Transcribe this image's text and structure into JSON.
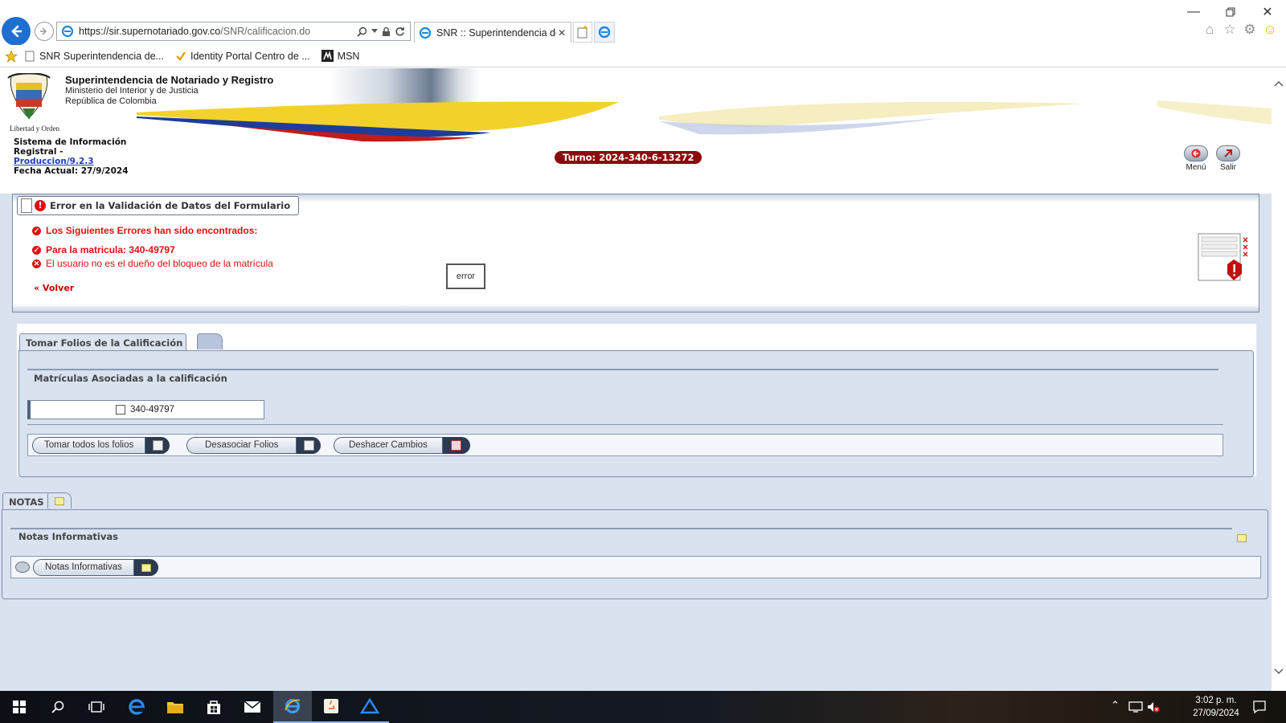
{
  "browser": {
    "url_host": "https://sir.supernotariado.gov.co",
    "url_path": "/SNR/calificacion.do",
    "tab_title": "SNR :: Superintendencia de ...",
    "favorites": [
      {
        "label": "SNR  Superintendencia de..."
      },
      {
        "label": "Identity Portal Centro de ..."
      },
      {
        "label": "MSN"
      }
    ]
  },
  "header": {
    "org_name": "Superintendencia de Notariado y Registro",
    "ministry": "Ministerio del Interior y de Justicia",
    "country": "República de Colombia",
    "motto": "Libertad y Orden",
    "system_line1": "Sistema de Información",
    "system_line2": "Registral -",
    "version_link": "Produccion/9.2.3",
    "fecha": "Fecha Actual: 27/9/2024",
    "turno": "Turno: 2024-340-6-13272",
    "menu_label": "Menú",
    "salir_label": "Salir"
  },
  "error_panel": {
    "title": "Error en la Validación de Datos del Formulario",
    "heading": "Los Siguientes Errores han sido encontrados:",
    "matricula_line": "Para la matricula: 340-49797",
    "detail": "El usuario no es el dueño del bloqueo de la matrícula",
    "back_link": "« Volver",
    "error_box": "error"
  },
  "calificacion": {
    "tab_label": "Tomar Folios de la Calificación",
    "section_title": "Matrículas Asociadas a la calificación",
    "matricula": "340-49797",
    "buttons": [
      {
        "label": "Tomar todos los folios"
      },
      {
        "label": "Desasociar Folios"
      },
      {
        "label": "Deshacer Cambios"
      }
    ]
  },
  "notas": {
    "tab_label": "NOTAS",
    "section_title": "Notas Informativas",
    "button_label": "Notas Informativas"
  },
  "taskbar": {
    "time": "3:02 p. m.",
    "date": "27/09/2024"
  },
  "colors": {
    "turno_bg": "#8b0a0a",
    "error_red": "#e01010",
    "panel_bg": "#d9e2ef",
    "browser_accent": "#1e6fd0"
  }
}
